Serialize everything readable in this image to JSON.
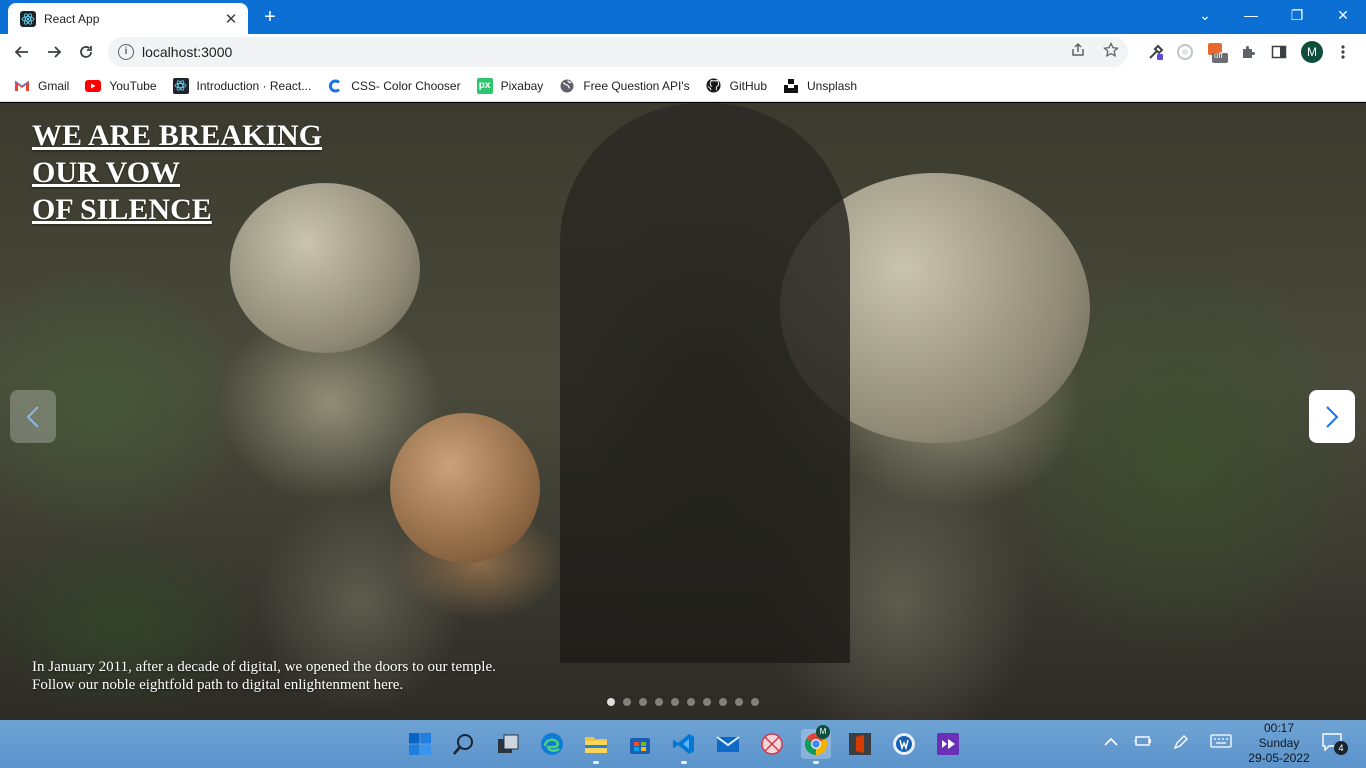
{
  "browser": {
    "tab_title": "React App",
    "tab_close": "✕",
    "new_tab": "+",
    "window_controls": {
      "dropdown": "⌄",
      "minimize": "—",
      "restore": "❐",
      "close": "✕"
    }
  },
  "toolbar": {
    "url": "localhost:3000",
    "info_icon": "i",
    "extension_badge": "off",
    "profile_initial": "M"
  },
  "bookmarks": [
    {
      "label": "Gmail",
      "icon": "gmail-icon"
    },
    {
      "label": "YouTube",
      "icon": "youtube-icon"
    },
    {
      "label": "Introduction · React...",
      "icon": "react-icon"
    },
    {
      "label": "CSS- Color Chooser",
      "icon": "css-color-icon"
    },
    {
      "label": "Pixabay",
      "icon": "pixabay-icon"
    },
    {
      "label": "Free Question API's",
      "icon": "globe-icon"
    },
    {
      "label": "GitHub",
      "icon": "github-icon"
    },
    {
      "label": "Unsplash",
      "icon": "unsplash-icon"
    }
  ],
  "carousel": {
    "headline_lines": [
      "WE ARE BREAKING",
      "OUR VOW",
      "OF SILENCE"
    ],
    "caption_lines": [
      "In January 2011, after a decade of digital, we opened the doors to our temple.",
      "Follow our noble eightfold path to digital enlightenment here."
    ],
    "slide_count": 10,
    "active_slide": 1
  },
  "taskbar": {
    "chrome_badge": "M",
    "clock_time": "00:17",
    "clock_day": "Sunday",
    "clock_date": "29-05-2022",
    "notification_count": "4"
  },
  "colors": {
    "titlebar": "#0b6fd4",
    "taskbar": "#5b93cb",
    "youtube": "#ff0000",
    "pixabay": "#2ec66d",
    "vscode": "#0078d4"
  }
}
